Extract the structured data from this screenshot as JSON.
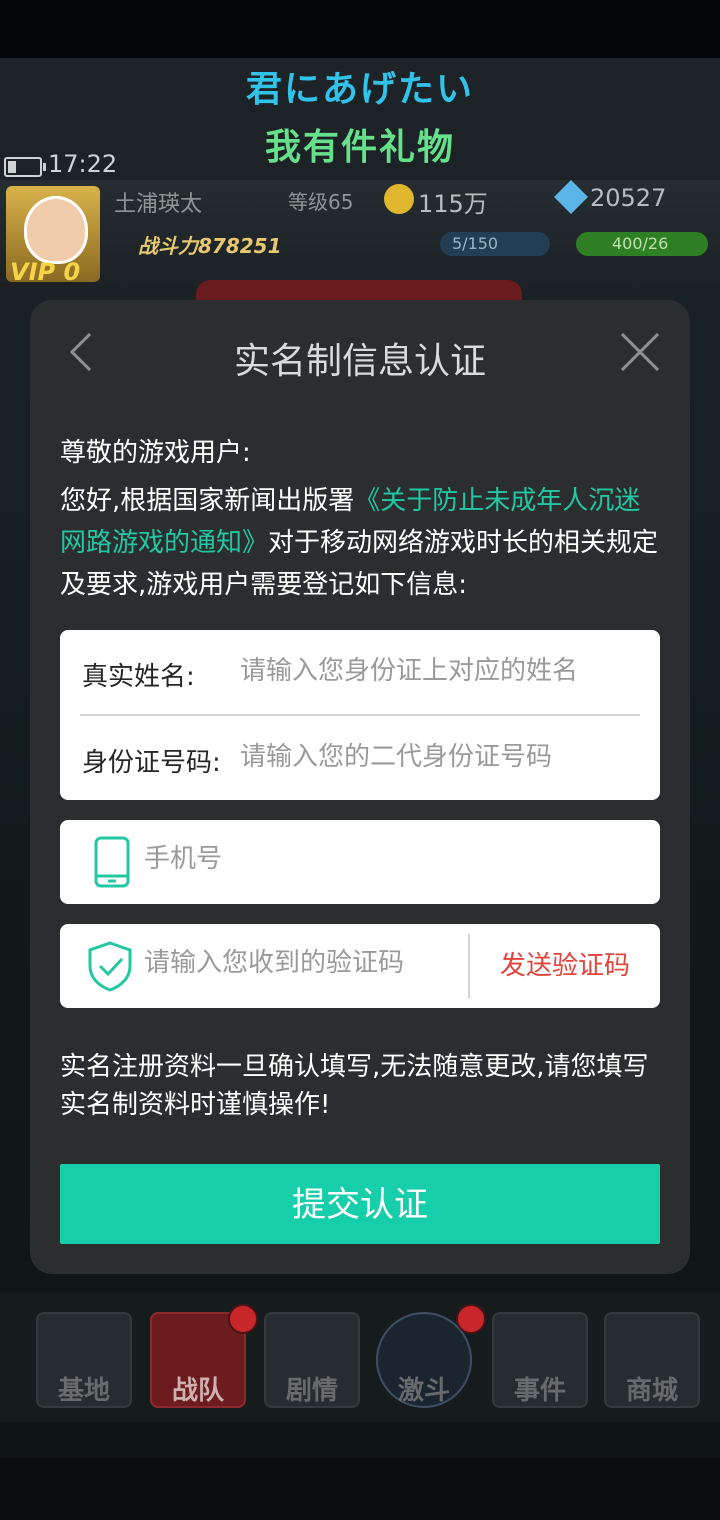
{
  "subtitles": {
    "line1": "君にあげたい",
    "line2": "我有件礼物"
  },
  "status": {
    "time": "17:22"
  },
  "player": {
    "name": "土浦瑛太",
    "level": "等级65",
    "coins": "115万",
    "gems": "20527",
    "power": "战斗力878251",
    "stamina": "5/150",
    "exp": "400/26",
    "vip": "VIP 0"
  },
  "bottom_nav": {
    "items": [
      "基地",
      "战队",
      "剧情",
      "激斗",
      "事件",
      "商城"
    ]
  },
  "modal": {
    "title": "实名制信息认证",
    "back_icon": "chevron-left-icon",
    "close_icon": "close-icon",
    "greeting": "尊敬的游戏用户:",
    "intro_before": "您好,根据国家新闻出版署",
    "intro_link": "《关于防止未成年人沉迷网路游戏的通知》",
    "intro_after": "对于移动网络游戏时长的相关规定及要求,游戏用户需要登记如下信息:",
    "name_label": "真实姓名:",
    "name_placeholder": "请输入您身份证上对应的姓名",
    "id_label": "身份证号码:",
    "id_placeholder": "请输入您的二代身份证号码",
    "phone_icon": "phone-icon",
    "phone_placeholder": "手机号",
    "code_icon": "shield-check-icon",
    "code_placeholder": "请输入您收到的验证码",
    "send_code": "发送验证码",
    "notice": "实名注册资料一旦确认填写,无法随意更改,请您填写实名制资料时谨慎操作!",
    "submit": "提交认证"
  },
  "colors": {
    "accent": "#17ceaa",
    "link": "#22c7a3",
    "send_code": "#e0443c",
    "modal_bg": "#2b2d2f"
  }
}
